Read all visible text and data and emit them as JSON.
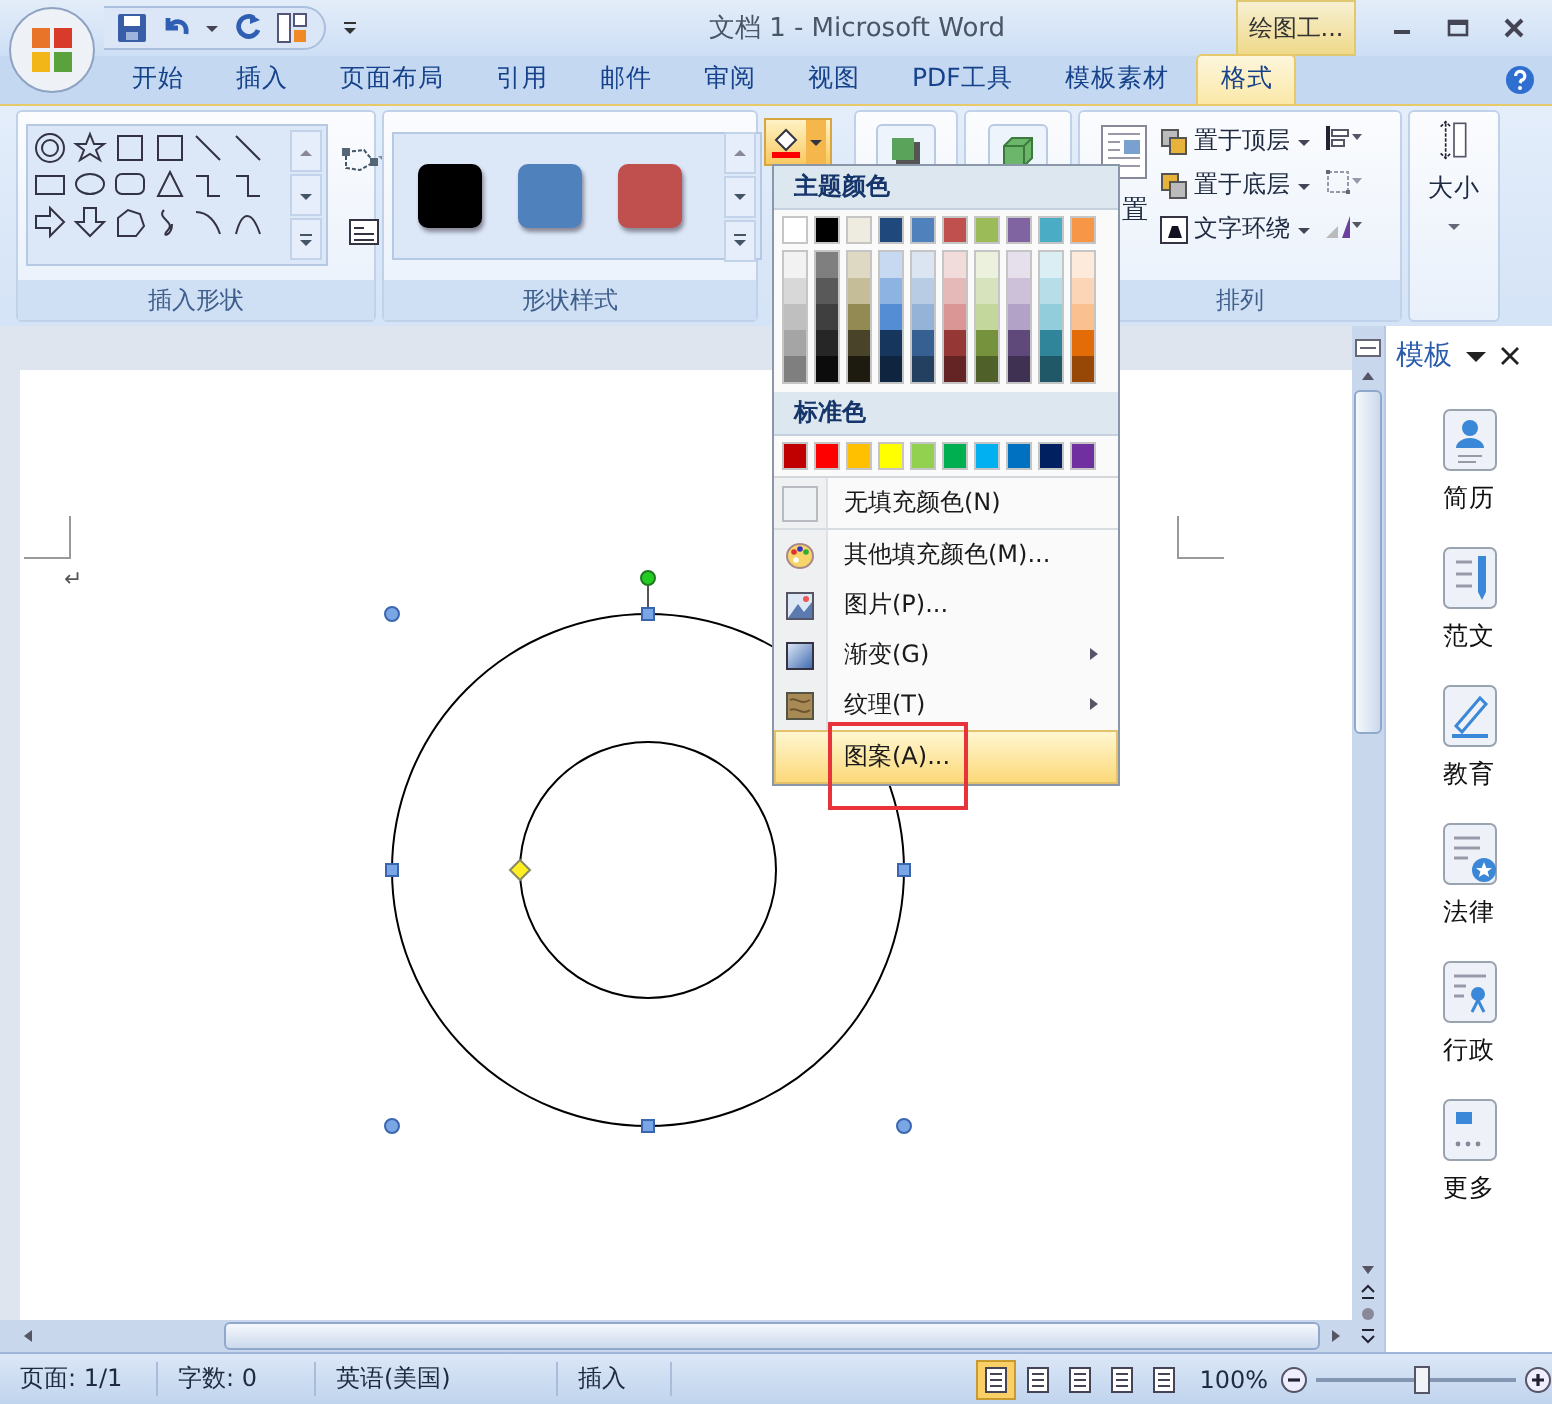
{
  "window": {
    "title": "文档 1 - Microsoft Word",
    "contextual_tab": "绘图工..."
  },
  "ribbon_tabs": [
    {
      "label": "开始",
      "selected": false
    },
    {
      "label": "插入",
      "selected": false
    },
    {
      "label": "页面布局",
      "selected": false
    },
    {
      "label": "引用",
      "selected": false
    },
    {
      "label": "邮件",
      "selected": false
    },
    {
      "label": "审阅",
      "selected": false
    },
    {
      "label": "视图",
      "selected": false
    },
    {
      "label": "PDF工具",
      "selected": false
    },
    {
      "label": "模板素材",
      "selected": false
    },
    {
      "label": "格式",
      "selected": true
    }
  ],
  "insert_shapes": {
    "label": "插入形状"
  },
  "shape_styles": {
    "label": "形状样式",
    "styles": [
      {
        "color": "#000000"
      },
      {
        "color": "#4f81bd"
      },
      {
        "color": "#c0504d"
      }
    ]
  },
  "arrange": {
    "label": "排列",
    "position_label": "置",
    "buttons": [
      {
        "label": "置于顶层",
        "kind": "front"
      },
      {
        "label": "置于底层",
        "kind": "back"
      },
      {
        "label": "文字环绕",
        "kind": "wrap"
      }
    ]
  },
  "size": {
    "label": "大小"
  },
  "fill_menu": {
    "theme_heading": "主题颜色",
    "theme_colors": [
      {
        "color": "#ffffff",
        "shades": [
          {
            "color": "#f2f2f2"
          },
          {
            "color": "#d8d8d8"
          },
          {
            "color": "#bfbfbf"
          },
          {
            "color": "#a5a5a5"
          },
          {
            "color": "#7f7f7f"
          }
        ]
      },
      {
        "color": "#000000",
        "shades": [
          {
            "color": "#7f7f7f"
          },
          {
            "color": "#595959"
          },
          {
            "color": "#3f3f3f"
          },
          {
            "color": "#262626"
          },
          {
            "color": "#0c0c0c"
          }
        ]
      },
      {
        "color": "#eeece1",
        "shades": [
          {
            "color": "#ddd9c3"
          },
          {
            "color": "#c4bd97"
          },
          {
            "color": "#938953"
          },
          {
            "color": "#494429"
          },
          {
            "color": "#1d1b10"
          }
        ]
      },
      {
        "color": "#1f497d",
        "shades": [
          {
            "color": "#c6d9f0"
          },
          {
            "color": "#8db3e2"
          },
          {
            "color": "#548dd4"
          },
          {
            "color": "#17365d"
          },
          {
            "color": "#0f243e"
          }
        ]
      },
      {
        "color": "#4f81bd",
        "shades": [
          {
            "color": "#dbe5f1"
          },
          {
            "color": "#b8cce4"
          },
          {
            "color": "#95b3d7"
          },
          {
            "color": "#366092"
          },
          {
            "color": "#244061"
          }
        ]
      },
      {
        "color": "#c0504d",
        "shades": [
          {
            "color": "#f2dcdb"
          },
          {
            "color": "#e5b9b7"
          },
          {
            "color": "#d99694"
          },
          {
            "color": "#953734"
          },
          {
            "color": "#632423"
          }
        ]
      },
      {
        "color": "#9bbb59",
        "shades": [
          {
            "color": "#ebf1dd"
          },
          {
            "color": "#d7e3bc"
          },
          {
            "color": "#c3d69b"
          },
          {
            "color": "#76923c"
          },
          {
            "color": "#4f6128"
          }
        ]
      },
      {
        "color": "#8064a2",
        "shades": [
          {
            "color": "#e5e0ec"
          },
          {
            "color": "#ccc1d9"
          },
          {
            "color": "#b2a2c7"
          },
          {
            "color": "#5f497a"
          },
          {
            "color": "#3f3151"
          }
        ]
      },
      {
        "color": "#4bacc6",
        "shades": [
          {
            "color": "#dbeef3"
          },
          {
            "color": "#b7dde8"
          },
          {
            "color": "#92cddc"
          },
          {
            "color": "#31859b"
          },
          {
            "color": "#205867"
          }
        ]
      },
      {
        "color": "#f79646",
        "shades": [
          {
            "color": "#fdeada"
          },
          {
            "color": "#fbd5b5"
          },
          {
            "color": "#fac08f"
          },
          {
            "color": "#e36c09"
          },
          {
            "color": "#974806"
          }
        ]
      }
    ],
    "standard_heading": "标准色",
    "standard_colors": [
      {
        "color": "#c00000"
      },
      {
        "color": "#ff0000"
      },
      {
        "color": "#ffc000"
      },
      {
        "color": "#ffff00"
      },
      {
        "color": "#92d050"
      },
      {
        "color": "#00b050"
      },
      {
        "color": "#00b0f0"
      },
      {
        "color": "#0070c0"
      },
      {
        "color": "#002060"
      },
      {
        "color": "#7030a0"
      }
    ],
    "items": [
      {
        "label": "无填充颜色(N)",
        "kind": "no-fill",
        "submenu": false,
        "selected": false
      },
      {
        "label": "其他填充颜色(M)...",
        "kind": "palette",
        "submenu": false,
        "selected": false
      },
      {
        "label": "图片(P)...",
        "kind": "picture",
        "submenu": false,
        "selected": false
      },
      {
        "label": "渐变(G)",
        "kind": "gradient",
        "submenu": true,
        "selected": false
      },
      {
        "label": "纹理(T)",
        "kind": "texture",
        "submenu": true,
        "selected": false
      },
      {
        "label": "图案(A)...",
        "kind": "pattern",
        "submenu": false,
        "selected": true
      }
    ]
  },
  "document": {
    "paragraph_mark": "↵"
  },
  "template_panel": {
    "title": "模板",
    "items": [
      {
        "label": "简历",
        "kind": "resume"
      },
      {
        "label": "范文",
        "kind": "essay"
      },
      {
        "label": "教育",
        "kind": "education"
      },
      {
        "label": "法律",
        "kind": "law"
      },
      {
        "label": "行政",
        "kind": "admin"
      },
      {
        "label": "更多",
        "kind": "more"
      }
    ]
  },
  "status_bar": {
    "page": "页面: 1/1",
    "words": "字数: 0",
    "language": "英语(美国)",
    "mode": "插入",
    "views": [
      {
        "selected": true
      },
      {
        "selected": false
      },
      {
        "selected": false
      },
      {
        "selected": false
      },
      {
        "selected": false
      }
    ],
    "zoom": "100%",
    "zoom_slider": {
      "level": 0.52
    }
  }
}
